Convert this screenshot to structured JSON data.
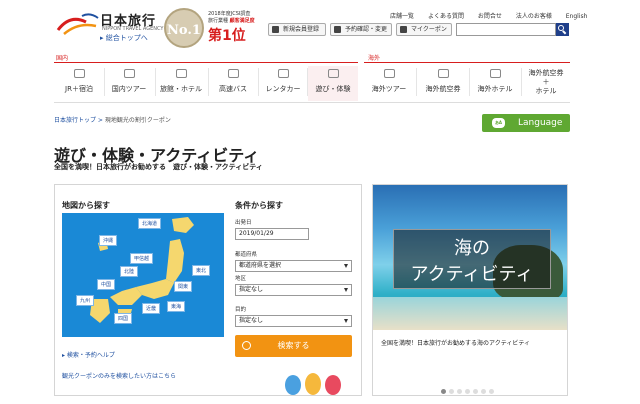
{
  "header": {
    "logo_main": "日本旅行",
    "logo_sub": "NIPPON TRAVEL AGENCY",
    "logo_top_link": "▸ 総合トップへ",
    "badge_text": "No.1",
    "award_line1": "2018年度JCSI調査",
    "award_line2_pre": "旅行業種",
    "award_line2_em": "顧客満足度",
    "award_rank": "第1位",
    "utility_links": [
      "店舗一覧",
      "よくある質問",
      "お問合せ",
      "法人のお客様",
      "English"
    ],
    "tool_buttons": [
      "新規会員登録",
      "予約確認・変更",
      "マイクーポン"
    ],
    "search_placeholder": ""
  },
  "nav": {
    "domestic_label": "国内",
    "overseas_label": "海外",
    "domestic_items": [
      "JR＋宿泊",
      "国内ツアー",
      "旅館・ホテル",
      "高速バス",
      "レンタカー",
      "遊び・体験"
    ],
    "overseas_items": [
      "海外ツアー",
      "海外航空券",
      "海外ホテル",
      "海外航空券\n＋\nホテル"
    ],
    "active_item": "遊び・体験"
  },
  "breadcrumb": {
    "home": "日本旅行トップ",
    "separator": " > ",
    "current": "現地観光の割引クーポン"
  },
  "language_button": {
    "badge": "あA",
    "label": "Language"
  },
  "page": {
    "title": "遊び・体験・アクティビティ",
    "subtitle": "全国を満喫！日本旅行がお勧めする　遊び・体験・アクティビティ"
  },
  "search_panel": {
    "map_heading": "地図から探す",
    "regions": [
      "北海道",
      "沖縄",
      "東北",
      "甲信越",
      "北陸",
      "関東",
      "中国",
      "九州",
      "近畿",
      "東海",
      "四国"
    ],
    "conditions_heading": "条件から探す",
    "date_label": "出発日",
    "date_value": "2019/01/29",
    "pref_label": "都道府県",
    "pref_value": "都道府県を選択",
    "area_label": "地区",
    "area_value": "指定なし",
    "purpose_label": "目的",
    "purpose_value": "指定なし",
    "search_button": "検索する",
    "help_link": "▸ 検索・予約ヘルプ",
    "coupon_link": "観光クーポンのみを検索したい方はこちら"
  },
  "banner": {
    "sign_line1": "海のアクティビティ",
    "caption": "全国を満喫！日本旅行がお勧めする海のアクティビティ",
    "dot_count": 7,
    "active_dot": 0
  },
  "colors": {
    "brand_red": "#d71e1e",
    "link_blue": "#1f50a0",
    "language_green": "#5fa832",
    "search_orange": "#f29312",
    "map_blue": "#1a89d6"
  }
}
